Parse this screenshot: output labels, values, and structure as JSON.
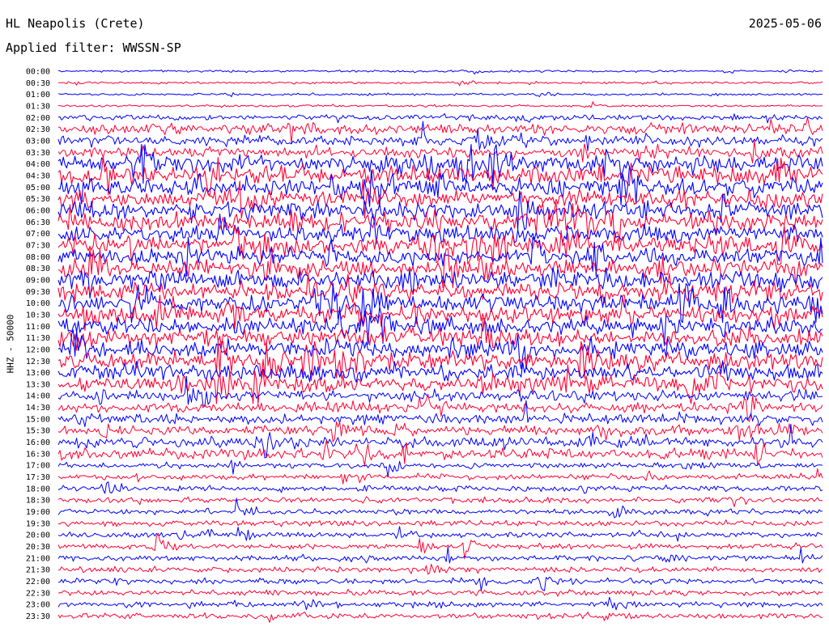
{
  "header": {
    "station": "HL Neapolis (Crete)",
    "filter": "Applied filter: WWSSN-SP",
    "date": "2025-05-06"
  },
  "chart_data": {
    "type": "helicorder",
    "title": "HL Neapolis (Crete)",
    "subtitle": "Applied filter: WWSSN-SP",
    "date": "2025-05-06",
    "ylabel": "HHZ - 50000",
    "line_minutes": 30,
    "colors": [
      "#0000ff",
      "#ff0033"
    ],
    "lines": [
      {
        "time": "00:00",
        "activity": 1
      },
      {
        "time": "00:30",
        "activity": 1
      },
      {
        "time": "01:00",
        "activity": 1
      },
      {
        "time": "01:30",
        "activity": 1
      },
      {
        "time": "02:00",
        "activity": 2
      },
      {
        "time": "02:30",
        "activity": 3
      },
      {
        "time": "03:00",
        "activity": 3
      },
      {
        "time": "03:30",
        "activity": 3
      },
      {
        "time": "04:00",
        "activity": 4
      },
      {
        "time": "04:30",
        "activity": 4
      },
      {
        "time": "05:00",
        "activity": 4
      },
      {
        "time": "05:30",
        "activity": 4
      },
      {
        "time": "06:00",
        "activity": 4
      },
      {
        "time": "06:30",
        "activity": 4
      },
      {
        "time": "07:00",
        "activity": 4
      },
      {
        "time": "07:30",
        "activity": 4
      },
      {
        "time": "08:00",
        "activity": 4
      },
      {
        "time": "08:30",
        "activity": 4
      },
      {
        "time": "09:00",
        "activity": 4
      },
      {
        "time": "09:30",
        "activity": 4
      },
      {
        "time": "10:00",
        "activity": 4
      },
      {
        "time": "10:30",
        "activity": 4
      },
      {
        "time": "11:00",
        "activity": 4
      },
      {
        "time": "11:30",
        "activity": 4
      },
      {
        "time": "12:00",
        "activity": 4
      },
      {
        "time": "12:30",
        "activity": 4
      },
      {
        "time": "13:00",
        "activity": 4
      },
      {
        "time": "13:30",
        "activity": 4
      },
      {
        "time": "14:00",
        "activity": 3
      },
      {
        "time": "14:30",
        "activity": 3
      },
      {
        "time": "15:00",
        "activity": 3
      },
      {
        "time": "15:30",
        "activity": 3
      },
      {
        "time": "16:00",
        "activity": 3
      },
      {
        "time": "16:30",
        "activity": 3
      },
      {
        "time": "17:00",
        "activity": 2
      },
      {
        "time": "17:30",
        "activity": 2
      },
      {
        "time": "18:00",
        "activity": 2
      },
      {
        "time": "18:30",
        "activity": 2
      },
      {
        "time": "19:00",
        "activity": 2
      },
      {
        "time": "19:30",
        "activity": 2
      },
      {
        "time": "20:00",
        "activity": 2
      },
      {
        "time": "20:30",
        "activity": 2
      },
      {
        "time": "21:00",
        "activity": 2
      },
      {
        "time": "21:30",
        "activity": 2
      },
      {
        "time": "22:00",
        "activity": 2
      },
      {
        "time": "22:30",
        "activity": 2
      },
      {
        "time": "23:00",
        "activity": 2
      },
      {
        "time": "23:30",
        "activity": 2
      }
    ]
  }
}
